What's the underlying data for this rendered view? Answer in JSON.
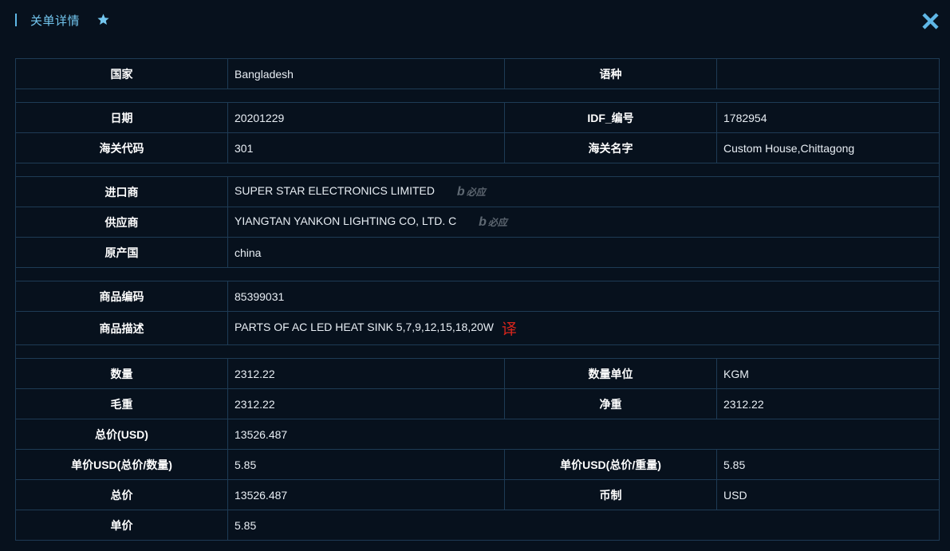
{
  "header": {
    "title": "关单详情",
    "star_icon": "star-icon",
    "close_icon": "close-icon",
    "accent_color": "#73c6ef"
  },
  "fields": {
    "country_label": "国家",
    "country": "Bangladesh",
    "language_label": "语种",
    "language": "",
    "date_label": "日期",
    "date": "20201229",
    "idf_label": "IDF_编号",
    "idf": "1782954",
    "customs_code_label": "海关代码",
    "customs_code": "301",
    "customs_name_label": "海关名字",
    "customs_name": "Custom House,Chittagong",
    "importer_label": "进口商",
    "importer": "SUPER STAR ELECTRONICS LIMITED",
    "supplier_label": "供应商",
    "supplier": "YIANGTAN YANKON LIGHTING CO, LTD. C",
    "origin_label": "原产国",
    "origin": "china",
    "hs_code_label": "商品编码",
    "hs_code": "85399031",
    "description_label": "商品描述",
    "description": "PARTS OF AC LED HEAT SINK 5,7,9,12,15,18,20W",
    "translate_label": "译",
    "quantity_label": "数量",
    "quantity": "2312.22",
    "quantity_unit_label": "数量单位",
    "quantity_unit": "KGM",
    "gross_weight_label": "毛重",
    "gross_weight": "2312.22",
    "net_weight_label": "净重",
    "net_weight": "2312.22",
    "total_usd_label": "总价(USD)",
    "total_usd": "13526.487",
    "unit_usd_qty_label": "单价USD(总价/数量)",
    "unit_usd_qty": "5.85",
    "unit_usd_weight_label": "单价USD(总价/重量)",
    "unit_usd_weight": "5.85",
    "total_label": "总价",
    "total": "13526.487",
    "currency_label": "币制",
    "currency": "USD",
    "unit_price_label": "单价",
    "unit_price": "5.85"
  },
  "bing": {
    "logo": "b",
    "text": "必应"
  }
}
